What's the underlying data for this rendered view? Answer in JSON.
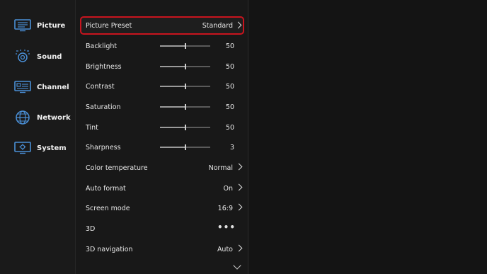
{
  "sidebar": {
    "items": [
      {
        "label": "Picture",
        "icon": "picture-icon"
      },
      {
        "label": "Sound",
        "icon": "sound-icon"
      },
      {
        "label": "Channel",
        "icon": "channel-icon"
      },
      {
        "label": "Network",
        "icon": "network-icon"
      },
      {
        "label": "System",
        "icon": "system-icon"
      }
    ]
  },
  "settings": {
    "preset": {
      "label": "Picture Preset",
      "value": "Standard"
    },
    "backlight": {
      "label": "Backlight",
      "value": "50",
      "level": 50
    },
    "brightness": {
      "label": "Brightness",
      "value": "50",
      "level": 50
    },
    "contrast": {
      "label": "Contrast",
      "value": "50",
      "level": 50
    },
    "saturation": {
      "label": "Saturation",
      "value": "50",
      "level": 50
    },
    "tint": {
      "label": "Tint",
      "value": "50",
      "level": 50
    },
    "sharpness": {
      "label": "Sharpness",
      "value": "3",
      "level": 50
    },
    "color_temperature": {
      "label": "Color temperature",
      "value": "Normal"
    },
    "auto_format": {
      "label": "Auto format",
      "value": "On"
    },
    "screen_mode": {
      "label": "Screen mode",
      "value": "16:9"
    },
    "three_d": {
      "label": "3D",
      "value": "•••"
    },
    "three_d_nav": {
      "label": "3D navigation",
      "value": "Auto"
    }
  },
  "colors": {
    "accent": "#c8141e",
    "background": "#141414",
    "text": "#e8e8e8"
  }
}
